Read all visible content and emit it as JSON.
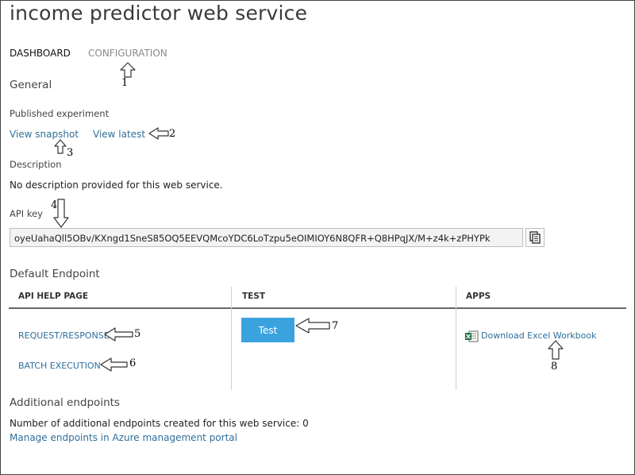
{
  "header": {
    "title": "income predictor web service"
  },
  "tabs": [
    {
      "label": "DASHBOARD",
      "active": true
    },
    {
      "label": "CONFIGURATION",
      "active": false
    }
  ],
  "general": {
    "section_title": "General",
    "published_label": "Published experiment",
    "view_snapshot": "View snapshot",
    "view_latest": "View latest",
    "description_label": "Description",
    "description_text": "No description provided for this web service.",
    "api_key_label": "API key",
    "api_key_value": "oyeUahaQll5OBv/KXngd1SneS85OQ5EEVQMcoYDC6LoTzpu5eOIMIOY6N8QFR+Q8HPqJX/M+z4k+zPHYPk"
  },
  "endpoint": {
    "section_title": "Default Endpoint",
    "columns": [
      "API HELP PAGE",
      "TEST",
      "APPS"
    ],
    "request_response": "REQUEST/RESPONSE",
    "batch_execution": "BATCH EXECUTION",
    "test_button": "Test",
    "download_excel": "Download Excel Workbook"
  },
  "additional": {
    "section_title": "Additional endpoints",
    "count_text": "Number of additional endpoints created for this web service: 0",
    "manage_link": "Manage endpoints in Azure management portal"
  },
  "annotations": [
    "1",
    "2",
    "3",
    "4",
    "5",
    "6",
    "7",
    "8"
  ],
  "colors": {
    "link": "#2f6f9a",
    "accent": "#3aa3de",
    "excel": "#1d7044"
  }
}
